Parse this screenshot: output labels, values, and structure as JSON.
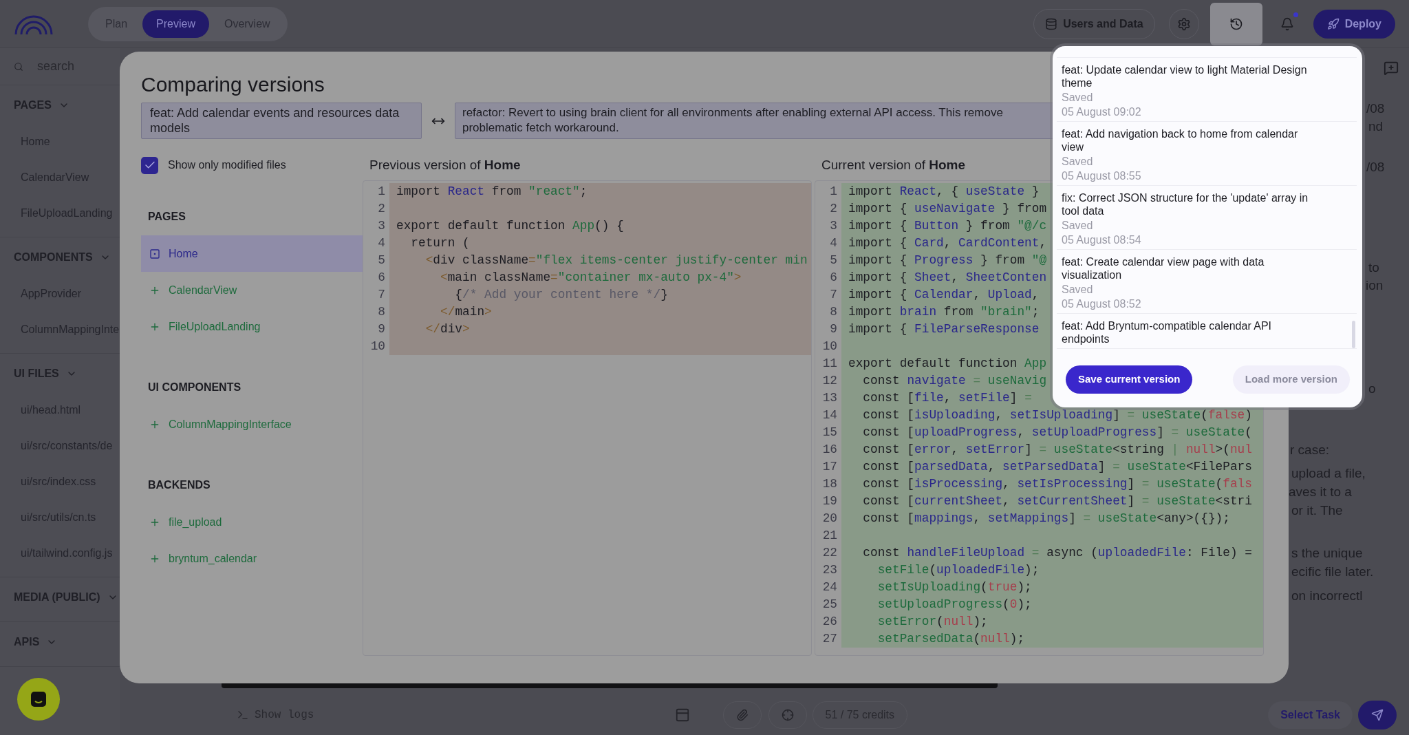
{
  "topbar": {
    "tabs": [
      {
        "label": "Plan",
        "selected": false
      },
      {
        "label": "Preview",
        "selected": true
      },
      {
        "label": "Overview",
        "selected": false
      }
    ],
    "users_button": "Users and Data",
    "history_active": true,
    "notification_dot": true,
    "deploy_button": "Deploy"
  },
  "sidebar": {
    "search": {
      "placeholder": "search"
    },
    "sections": [
      {
        "title": "PAGES",
        "items": [
          "Home",
          "CalendarView",
          "FileUploadLanding"
        ]
      },
      {
        "title": "COMPONENTS",
        "items": [
          "AppProvider",
          "ColumnMappingInte"
        ]
      },
      {
        "title": "UI FILES",
        "items": [
          "ui/head.html",
          "ui/src/constants/de",
          "ui/src/index.css",
          "ui/src/utils/cn.ts",
          "ui/tailwind.config.js"
        ]
      },
      {
        "title": "MEDIA (PUBLIC)"
      },
      {
        "title": "APIS"
      }
    ]
  },
  "chat_fragments": [
    "/08",
    "nd",
    "/08",
    "to",
    "ion",
    "o",
    "r case:",
    "upload a file,",
    "aves it to a",
    "or it. The",
    "s the unique",
    "ecific file later.",
    "on incorrectl"
  ],
  "bottom_bar": {
    "logs_label": "Show logs",
    "credits": "51 / 75 credits",
    "task_button": "Select Task"
  },
  "dialog": {
    "title": "Comparing versions",
    "from_version": "feat: Add calendar events and resources data models",
    "to_version": "refactor: Revert to using brain client for all environments after enabling external API access. This remove problematic fetch workaround.",
    "only_modified": {
      "label": "Show only modified files",
      "checked": true
    },
    "groups": [
      {
        "title": "PAGES",
        "files": [
          {
            "name": "Home",
            "kind": "modified",
            "selected": true
          },
          {
            "name": "CalendarView",
            "kind": "added",
            "selected": false
          },
          {
            "name": "FileUploadLanding",
            "kind": "added",
            "selected": false
          }
        ]
      },
      {
        "title": "UI COMPONENTS",
        "files": [
          {
            "name": "ColumnMappingInterface",
            "kind": "added",
            "selected": false
          }
        ]
      },
      {
        "title": "BACKENDS",
        "files": [
          {
            "name": "file_upload",
            "kind": "added",
            "selected": false
          },
          {
            "name": "bryntum_calendar",
            "kind": "added",
            "selected": false
          }
        ]
      }
    ],
    "previous": {
      "heading": "Previous version of **Home**",
      "kind": "removed",
      "lines": [
        {
          "number": "1",
          "tokens": [
            {
              "kind": "plain",
              "text": "import "
            },
            {
              "kind": "ident",
              "text": "React"
            },
            {
              "kind": "plain",
              "text": " from "
            },
            {
              "kind": "green",
              "text": "\"react\""
            },
            {
              "kind": "plain",
              "text": ";"
            }
          ]
        },
        {
          "number": "2"
        },
        {
          "number": "3",
          "tokens": [
            {
              "kind": "plain",
              "text": "export default function "
            },
            {
              "kind": "green",
              "text": "App"
            },
            {
              "kind": "plain",
              "text": "() {"
            }
          ]
        },
        {
          "number": "4",
          "tokens": [
            {
              "kind": "plain",
              "text": "  return ("
            }
          ]
        },
        {
          "number": "5",
          "tokens": [
            {
              "kind": "tag",
              "text": "    <"
            },
            {
              "kind": "plain",
              "text": "div className"
            },
            {
              "kind": "tag",
              "text": "="
            },
            {
              "kind": "green",
              "text": "\"flex items-center justify-center min"
            }
          ]
        },
        {
          "number": "6",
          "tokens": [
            {
              "kind": "tag",
              "text": "      <"
            },
            {
              "kind": "plain",
              "text": "main className"
            },
            {
              "kind": "tag",
              "text": "="
            },
            {
              "kind": "green",
              "text": "\"container mx-auto px-4\""
            },
            {
              "kind": "tag",
              "text": ">"
            }
          ]
        },
        {
          "number": "7",
          "tokens": [
            {
              "kind": "plain",
              "text": "        {"
            },
            {
              "kind": "comment",
              "text": "/* Add your content here */"
            },
            {
              "kind": "plain",
              "text": "}"
            }
          ]
        },
        {
          "number": "8",
          "tokens": [
            {
              "kind": "tag",
              "text": "      </"
            },
            {
              "kind": "plain",
              "text": "main"
            },
            {
              "kind": "tag",
              "text": ">"
            }
          ]
        },
        {
          "number": "9",
          "tokens": [
            {
              "kind": "tag",
              "text": "    </"
            },
            {
              "kind": "plain",
              "text": "div"
            },
            {
              "kind": "tag",
              "text": ">"
            }
          ]
        },
        {
          "number": "10"
        }
      ]
    },
    "current": {
      "heading": "Current version of **Home**",
      "kind": "added",
      "lines": [
        {
          "number": "1",
          "tokens": [
            {
              "kind": "plain",
              "text": "import "
            },
            {
              "kind": "ident",
              "text": "React"
            },
            {
              "kind": "plain",
              "text": ", { "
            },
            {
              "kind": "ident",
              "text": "useState"
            },
            {
              "kind": "plain",
              "text": " }"
            }
          ]
        },
        {
          "number": "2",
          "tokens": [
            {
              "kind": "plain",
              "text": "import { "
            },
            {
              "kind": "ident",
              "text": "useNavigate"
            },
            {
              "kind": "plain",
              "text": " } from"
            }
          ]
        },
        {
          "number": "3",
          "tokens": [
            {
              "kind": "plain",
              "text": "import { "
            },
            {
              "kind": "ident",
              "text": "Button"
            },
            {
              "kind": "plain",
              "text": " } from "
            },
            {
              "kind": "green",
              "text": "\"@/c"
            }
          ]
        },
        {
          "number": "4",
          "tokens": [
            {
              "kind": "plain",
              "text": "import { "
            },
            {
              "kind": "ident",
              "text": "Card"
            },
            {
              "kind": "plain",
              "text": ", "
            },
            {
              "kind": "ident",
              "text": "CardContent"
            },
            {
              "kind": "plain",
              "text": ","
            }
          ]
        },
        {
          "number": "5",
          "tokens": [
            {
              "kind": "plain",
              "text": "import { "
            },
            {
              "kind": "ident",
              "text": "Progress"
            },
            {
              "kind": "plain",
              "text": " } from "
            },
            {
              "kind": "green",
              "text": "\"@"
            }
          ]
        },
        {
          "number": "6",
          "tokens": [
            {
              "kind": "plain",
              "text": "import { "
            },
            {
              "kind": "ident",
              "text": "Sheet"
            },
            {
              "kind": "plain",
              "text": ", "
            },
            {
              "kind": "ident",
              "text": "SheetConten"
            }
          ]
        },
        {
          "number": "7",
          "tokens": [
            {
              "kind": "plain",
              "text": "import { "
            },
            {
              "kind": "ident",
              "text": "Calendar"
            },
            {
              "kind": "plain",
              "text": ", "
            },
            {
              "kind": "ident",
              "text": "Upload"
            },
            {
              "kind": "plain",
              "text": ","
            }
          ]
        },
        {
          "number": "8",
          "tokens": [
            {
              "kind": "plain",
              "text": "import "
            },
            {
              "kind": "ident",
              "text": "brain"
            },
            {
              "kind": "plain",
              "text": " from "
            },
            {
              "kind": "green",
              "text": "\"brain\""
            },
            {
              "kind": "plain",
              "text": ";"
            }
          ]
        },
        {
          "number": "9",
          "tokens": [
            {
              "kind": "plain",
              "text": "import { "
            },
            {
              "kind": "ident",
              "text": "FileParseResponse"
            }
          ]
        },
        {
          "number": "10"
        },
        {
          "number": "11",
          "tokens": [
            {
              "kind": "plain",
              "text": "export default function "
            },
            {
              "kind": "green",
              "text": "App"
            }
          ]
        },
        {
          "number": "12",
          "tokens": [
            {
              "kind": "plain",
              "text": "  const "
            },
            {
              "kind": "ident",
              "text": "navigate"
            },
            {
              "kind": "op",
              "text": " = "
            },
            {
              "kind": "green",
              "text": "useNavig"
            }
          ]
        },
        {
          "number": "13",
          "tokens": [
            {
              "kind": "plain",
              "text": "  const ["
            },
            {
              "kind": "ident",
              "text": "file"
            },
            {
              "kind": "plain",
              "text": ", "
            },
            {
              "kind": "ident",
              "text": "setFile"
            },
            {
              "kind": "plain",
              "text": "] "
            },
            {
              "kind": "op",
              "text": "="
            }
          ]
        },
        {
          "number": "14",
          "tokens": [
            {
              "kind": "plain",
              "text": "  const ["
            },
            {
              "kind": "ident",
              "text": "isUploading"
            },
            {
              "kind": "plain",
              "text": ", "
            },
            {
              "kind": "ident",
              "text": "setIsUploading"
            },
            {
              "kind": "plain",
              "text": "] "
            },
            {
              "kind": "op",
              "text": "="
            },
            {
              "kind": "green",
              "text": " useState"
            },
            {
              "kind": "plain",
              "text": "("
            },
            {
              "kind": "literal",
              "text": "false"
            },
            {
              "kind": "plain",
              "text": ")"
            }
          ]
        },
        {
          "number": "15",
          "tokens": [
            {
              "kind": "plain",
              "text": "  const ["
            },
            {
              "kind": "ident",
              "text": "uploadProgress"
            },
            {
              "kind": "plain",
              "text": ", "
            },
            {
              "kind": "ident",
              "text": "setUploadProgress"
            },
            {
              "kind": "plain",
              "text": "] "
            },
            {
              "kind": "op",
              "text": "="
            },
            {
              "kind": "green",
              "text": " useState"
            },
            {
              "kind": "plain",
              "text": "("
            }
          ]
        },
        {
          "number": "16",
          "tokens": [
            {
              "kind": "plain",
              "text": "  const ["
            },
            {
              "kind": "ident",
              "text": "error"
            },
            {
              "kind": "plain",
              "text": ", "
            },
            {
              "kind": "ident",
              "text": "setError"
            },
            {
              "kind": "plain",
              "text": "] "
            },
            {
              "kind": "op",
              "text": "="
            },
            {
              "kind": "green",
              "text": " useState"
            },
            {
              "kind": "plain",
              "text": "<string "
            },
            {
              "kind": "op",
              "text": "|"
            },
            {
              "kind": "literal",
              "text": " null"
            },
            {
              "kind": "plain",
              "text": ">("
            },
            {
              "kind": "literal",
              "text": "nul"
            }
          ]
        },
        {
          "number": "17",
          "tokens": [
            {
              "kind": "plain",
              "text": "  const ["
            },
            {
              "kind": "ident",
              "text": "parsedData"
            },
            {
              "kind": "plain",
              "text": ", "
            },
            {
              "kind": "ident",
              "text": "setParsedData"
            },
            {
              "kind": "plain",
              "text": "] "
            },
            {
              "kind": "op",
              "text": "="
            },
            {
              "kind": "green",
              "text": " useState"
            },
            {
              "kind": "plain",
              "text": "<FilePars"
            }
          ]
        },
        {
          "number": "18",
          "tokens": [
            {
              "kind": "plain",
              "text": "  const ["
            },
            {
              "kind": "ident",
              "text": "isProcessing"
            },
            {
              "kind": "plain",
              "text": ", "
            },
            {
              "kind": "ident",
              "text": "setIsProcessing"
            },
            {
              "kind": "plain",
              "text": "] "
            },
            {
              "kind": "op",
              "text": "="
            },
            {
              "kind": "green",
              "text": " useState"
            },
            {
              "kind": "plain",
              "text": "("
            },
            {
              "kind": "literal",
              "text": "fals"
            }
          ]
        },
        {
          "number": "19",
          "tokens": [
            {
              "kind": "plain",
              "text": "  const ["
            },
            {
              "kind": "ident",
              "text": "currentSheet"
            },
            {
              "kind": "plain",
              "text": ", "
            },
            {
              "kind": "ident",
              "text": "setCurrentSheet"
            },
            {
              "kind": "plain",
              "text": "] "
            },
            {
              "kind": "op",
              "text": "="
            },
            {
              "kind": "green",
              "text": " useState"
            },
            {
              "kind": "plain",
              "text": "<stri"
            }
          ]
        },
        {
          "number": "20",
          "tokens": [
            {
              "kind": "plain",
              "text": "  const ["
            },
            {
              "kind": "ident",
              "text": "mappings"
            },
            {
              "kind": "plain",
              "text": ", "
            },
            {
              "kind": "ident",
              "text": "setMappings"
            },
            {
              "kind": "plain",
              "text": "] "
            },
            {
              "kind": "op",
              "text": "="
            },
            {
              "kind": "green",
              "text": " useState"
            },
            {
              "kind": "plain",
              "text": "<any>({});"
            }
          ]
        },
        {
          "number": "21"
        },
        {
          "number": "22",
          "tokens": [
            {
              "kind": "plain",
              "text": "  const "
            },
            {
              "kind": "ident",
              "text": "handleFileUpload"
            },
            {
              "kind": "op",
              "text": " = "
            },
            {
              "kind": "plain",
              "text": "async ("
            },
            {
              "kind": "ident",
              "text": "uploadedFile"
            },
            {
              "kind": "plain",
              "text": ": File) ="
            }
          ]
        },
        {
          "number": "23",
          "tokens": [
            {
              "kind": "green",
              "text": "    setFile"
            },
            {
              "kind": "plain",
              "text": "("
            },
            {
              "kind": "ident",
              "text": "uploadedFile"
            },
            {
              "kind": "plain",
              "text": ");"
            }
          ]
        },
        {
          "number": "24",
          "tokens": [
            {
              "kind": "green",
              "text": "    setIsUploading"
            },
            {
              "kind": "plain",
              "text": "("
            },
            {
              "kind": "literal",
              "text": "true"
            },
            {
              "kind": "plain",
              "text": ");"
            }
          ]
        },
        {
          "number": "25",
          "tokens": [
            {
              "kind": "green",
              "text": "    setUploadProgress"
            },
            {
              "kind": "plain",
              "text": "("
            },
            {
              "kind": "literal",
              "text": "0"
            },
            {
              "kind": "plain",
              "text": ");"
            }
          ]
        },
        {
          "number": "26",
          "tokens": [
            {
              "kind": "green",
              "text": "    setError"
            },
            {
              "kind": "plain",
              "text": "("
            },
            {
              "kind": "literal",
              "text": "null"
            },
            {
              "kind": "plain",
              "text": ");"
            }
          ]
        },
        {
          "number": "27",
          "tokens": [
            {
              "kind": "green",
              "text": "    setParsedData"
            },
            {
              "kind": "plain",
              "text": "("
            },
            {
              "kind": "literal",
              "text": "null"
            },
            {
              "kind": "plain",
              "text": ");"
            }
          ]
        }
      ]
    }
  },
  "versions_popup": {
    "versions": [
      {
        "message": "feat: Update calendar view to light Material Design theme",
        "status": "Saved",
        "date": "05 August 09:02"
      },
      {
        "message": "feat: Add navigation back to home from calendar view",
        "status": "Saved",
        "date": "05 August 08:55"
      },
      {
        "message": "fix: Correct JSON structure for the 'update' array in tool data",
        "status": "Saved",
        "date": "05 August 08:54"
      },
      {
        "message": "feat: Create calendar view page with data visualization",
        "status": "Saved",
        "date": "05 August 08:52"
      },
      {
        "message": "feat: Add Bryntum-compatible calendar API endpoints"
      }
    ],
    "save_button": "Save current version",
    "load_button": "Load more version"
  }
}
